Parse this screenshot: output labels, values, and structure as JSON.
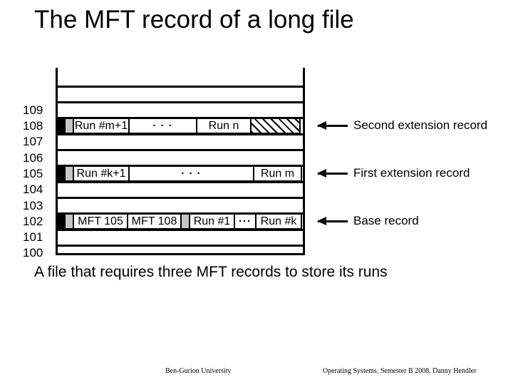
{
  "slide": {
    "title": "The MFT record of a long file",
    "caption": "A file that requires three MFT records to store its runs"
  },
  "footer": {
    "left": "Ben-Gurion University",
    "right": "Operating Systems, Semester B 2008, Danny Hendler"
  },
  "diagram": {
    "row_numbers": [
      "109",
      "108",
      "107",
      "106",
      "105",
      "104",
      "103",
      "102",
      "101",
      "100"
    ],
    "records": [
      {
        "id": "second-extension",
        "mft_number": "108",
        "segments": [
          {
            "kind": "black",
            "label": ""
          },
          {
            "kind": "gray",
            "label": ""
          },
          {
            "kind": "box",
            "label": "Run #m+1"
          },
          {
            "kind": "box",
            "label": "· · ·"
          },
          {
            "kind": "box",
            "label": "Run n"
          },
          {
            "kind": "hatch",
            "label": ""
          }
        ]
      },
      {
        "id": "first-extension",
        "mft_number": "105",
        "segments": [
          {
            "kind": "black",
            "label": ""
          },
          {
            "kind": "gray",
            "label": ""
          },
          {
            "kind": "box",
            "label": "Run #k+1"
          },
          {
            "kind": "box",
            "label": "· · ·"
          },
          {
            "kind": "box",
            "label": "Run m"
          }
        ]
      },
      {
        "id": "base",
        "mft_number": "102",
        "segments": [
          {
            "kind": "black",
            "label": ""
          },
          {
            "kind": "gray",
            "label": ""
          },
          {
            "kind": "box",
            "label": "MFT 105"
          },
          {
            "kind": "box",
            "label": "MFT 108"
          },
          {
            "kind": "gray",
            "label": ""
          },
          {
            "kind": "box",
            "label": "Run #1"
          },
          {
            "kind": "box",
            "label": "···"
          },
          {
            "kind": "box",
            "label": "Run #k"
          }
        ]
      }
    ],
    "callouts": [
      {
        "id": "second-extension",
        "label": "Second extension record"
      },
      {
        "id": "first-extension",
        "label": "First extension record"
      },
      {
        "id": "base",
        "label": "Base record"
      }
    ]
  },
  "colors": {
    "ink": "#000000",
    "background": "#ffffff",
    "gray_block": "#c7c7c7"
  }
}
